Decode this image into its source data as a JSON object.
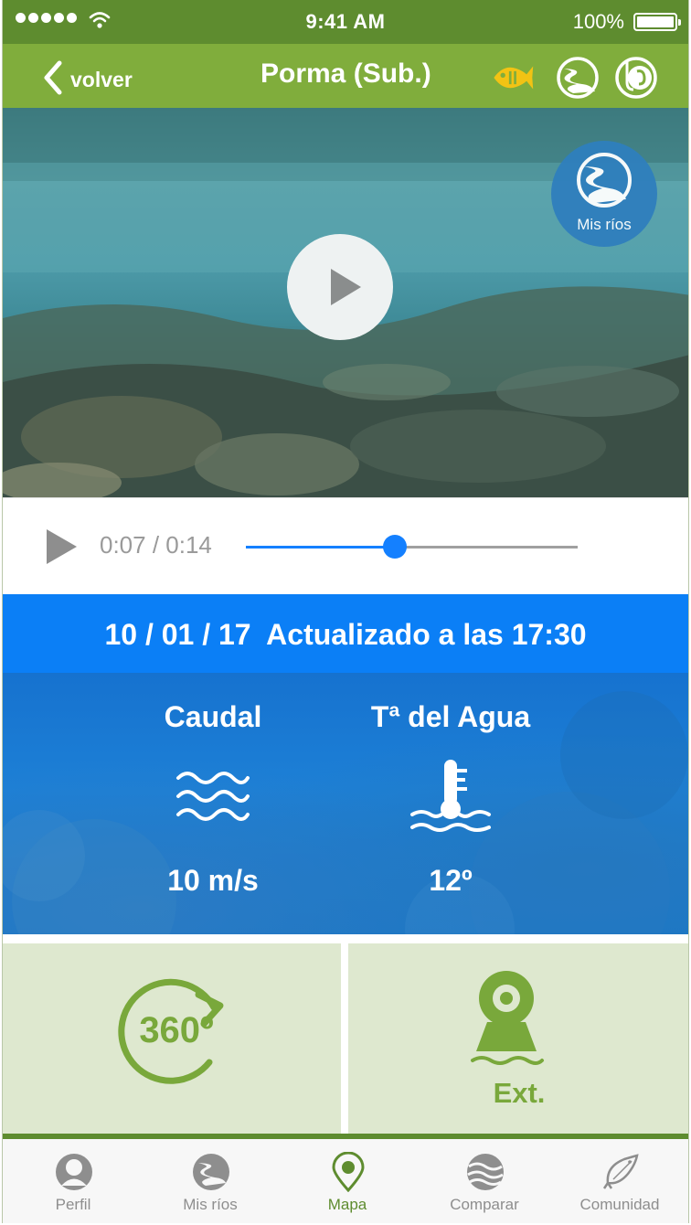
{
  "status_bar": {
    "time": "9:41 AM",
    "battery_percent": "100%",
    "signal_dots": 5,
    "battery_level": 1.0
  },
  "nav": {
    "back_label": "volver",
    "title": "Porma (Sub.)",
    "icons": [
      "fish-icon",
      "river-icon",
      "hook-icon"
    ]
  },
  "video": {
    "mis_rios_label": "Mis ríos",
    "progress": 0.45
  },
  "player": {
    "time_display": "0:07 / 0:14"
  },
  "update": {
    "text": "10 / 01 / 17  Actualizado a las 17:30"
  },
  "metrics": [
    {
      "label": "Caudal",
      "value": "10 m/s",
      "icon": "waves-icon"
    },
    {
      "label": "Tª del Agua",
      "value": "12º",
      "icon": "thermometer-icon"
    }
  ],
  "tiles": {
    "three_sixty_text": "360º",
    "ext_label": "Ext."
  },
  "tabs": [
    {
      "label": "Perfil",
      "icon": "profile-icon"
    },
    {
      "label": "Mis ríos",
      "icon": "river-icon"
    },
    {
      "label": "Mapa",
      "icon": "map-pin-icon",
      "active": true
    },
    {
      "label": "Comparar",
      "icon": "compare-icon"
    },
    {
      "label": "Comunidad",
      "icon": "fish-icon"
    }
  ],
  "colors": {
    "status_green": "#5e8c2f",
    "nav_green": "#80ad3c",
    "accent_blue": "#0b7ff6",
    "tile_bg": "#dee8cf",
    "fish_yellow": "#f2c314"
  }
}
